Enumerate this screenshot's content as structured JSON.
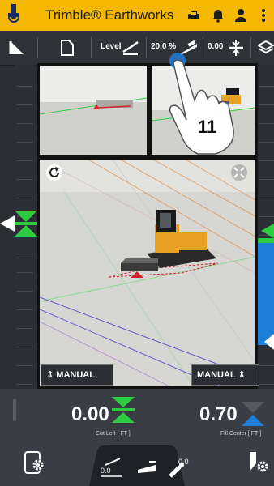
{
  "app": {
    "title": "Trimble® Earthworks"
  },
  "toolbar": {
    "level_label": "Level",
    "slope_value": "20.0 %",
    "offset_value": "0.00"
  },
  "gesture": {
    "step_number": "11"
  },
  "views": {
    "left_mode": "MANUAL",
    "right_mode": "MANUAL"
  },
  "readout": {
    "left_value": "0.00",
    "left_caption": "Cut Left",
    "left_unit": "[ FT ]",
    "right_value": "0.70",
    "right_caption": "Fill Center",
    "right_unit": "[ FT ]",
    "page_dots": 8,
    "page_active": 2
  },
  "colors": {
    "brand": "#f5b800",
    "on_grade": "#2ecc40",
    "fill": "#1e7fd9",
    "track_orange": "#e08a3c",
    "track_purple": "#6a5acd"
  },
  "icons": {
    "app_logo": "trimble-logo-icon",
    "top_right": [
      "vehicle-icon",
      "bell-icon",
      "user-icon",
      "more-vertical-icon"
    ],
    "toolbar": [
      "layers-split-icon",
      "file-icon",
      "level-slope-icon",
      "cross-slope-icon",
      "offset-icon",
      "layers-icon"
    ],
    "dock": [
      "device-settings-icon",
      "level-settings-icon",
      "blade-icon",
      "antenna-offset-icon",
      "machine-settings-icon"
    ]
  }
}
